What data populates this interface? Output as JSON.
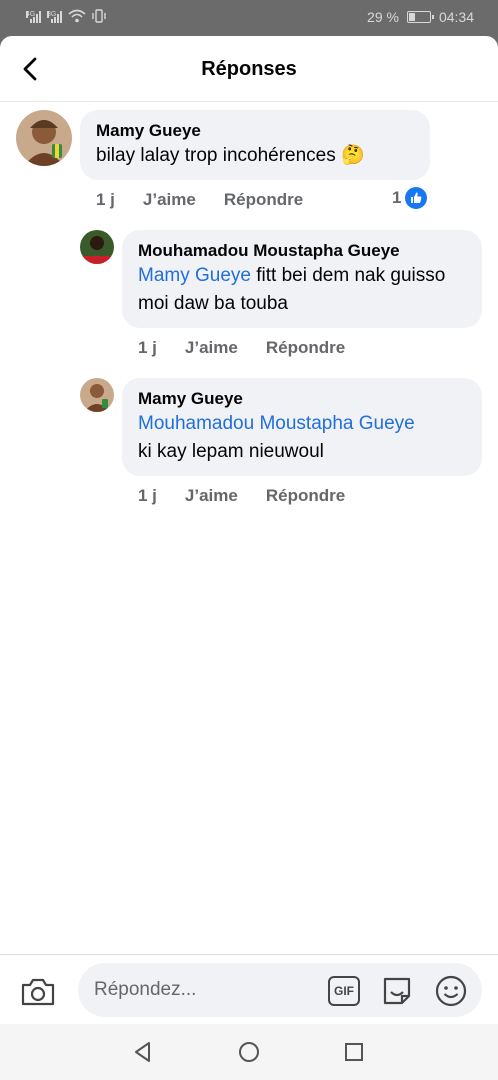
{
  "status_bar": {
    "signal_1_type": "4G",
    "signal_2_type": "3G",
    "battery": "29 %",
    "battery_level": 0.29,
    "time": "04:34"
  },
  "header": {
    "title": "Réponses",
    "back_icon": "chevron-left-icon"
  },
  "comments": [
    {
      "author": "Mamy Gueye",
      "mention": "",
      "text": "bilay lalay trop incohérences 🤔",
      "time": "1 j",
      "like_label": "J’aime",
      "reply_label": "Répondre",
      "like_count": "1"
    },
    {
      "author": "Mouhamadou Moustapha Gueye",
      "mention": "Mamy Gueye",
      "text": " fitt bei dem nak guisso moi daw ba touba",
      "time": "1 j",
      "like_label": "J’aime",
      "reply_label": "Répondre"
    },
    {
      "author": "Mamy Gueye",
      "mention": "Mouhamadou Moustapha Gueye",
      "text": "ki kay lepam nieuwoul",
      "time": "1 j",
      "like_label": "J’aime",
      "reply_label": "Répondre"
    }
  ],
  "composer": {
    "placeholder": "Répondez...",
    "gif_label": "GIF",
    "icons": [
      "camera-icon",
      "gif-icon",
      "sticker-icon",
      "emoji-icon"
    ]
  },
  "colors": {
    "mention": "#216fdb",
    "like_blue": "#1877f2",
    "bubble": "#f0f2f5"
  }
}
